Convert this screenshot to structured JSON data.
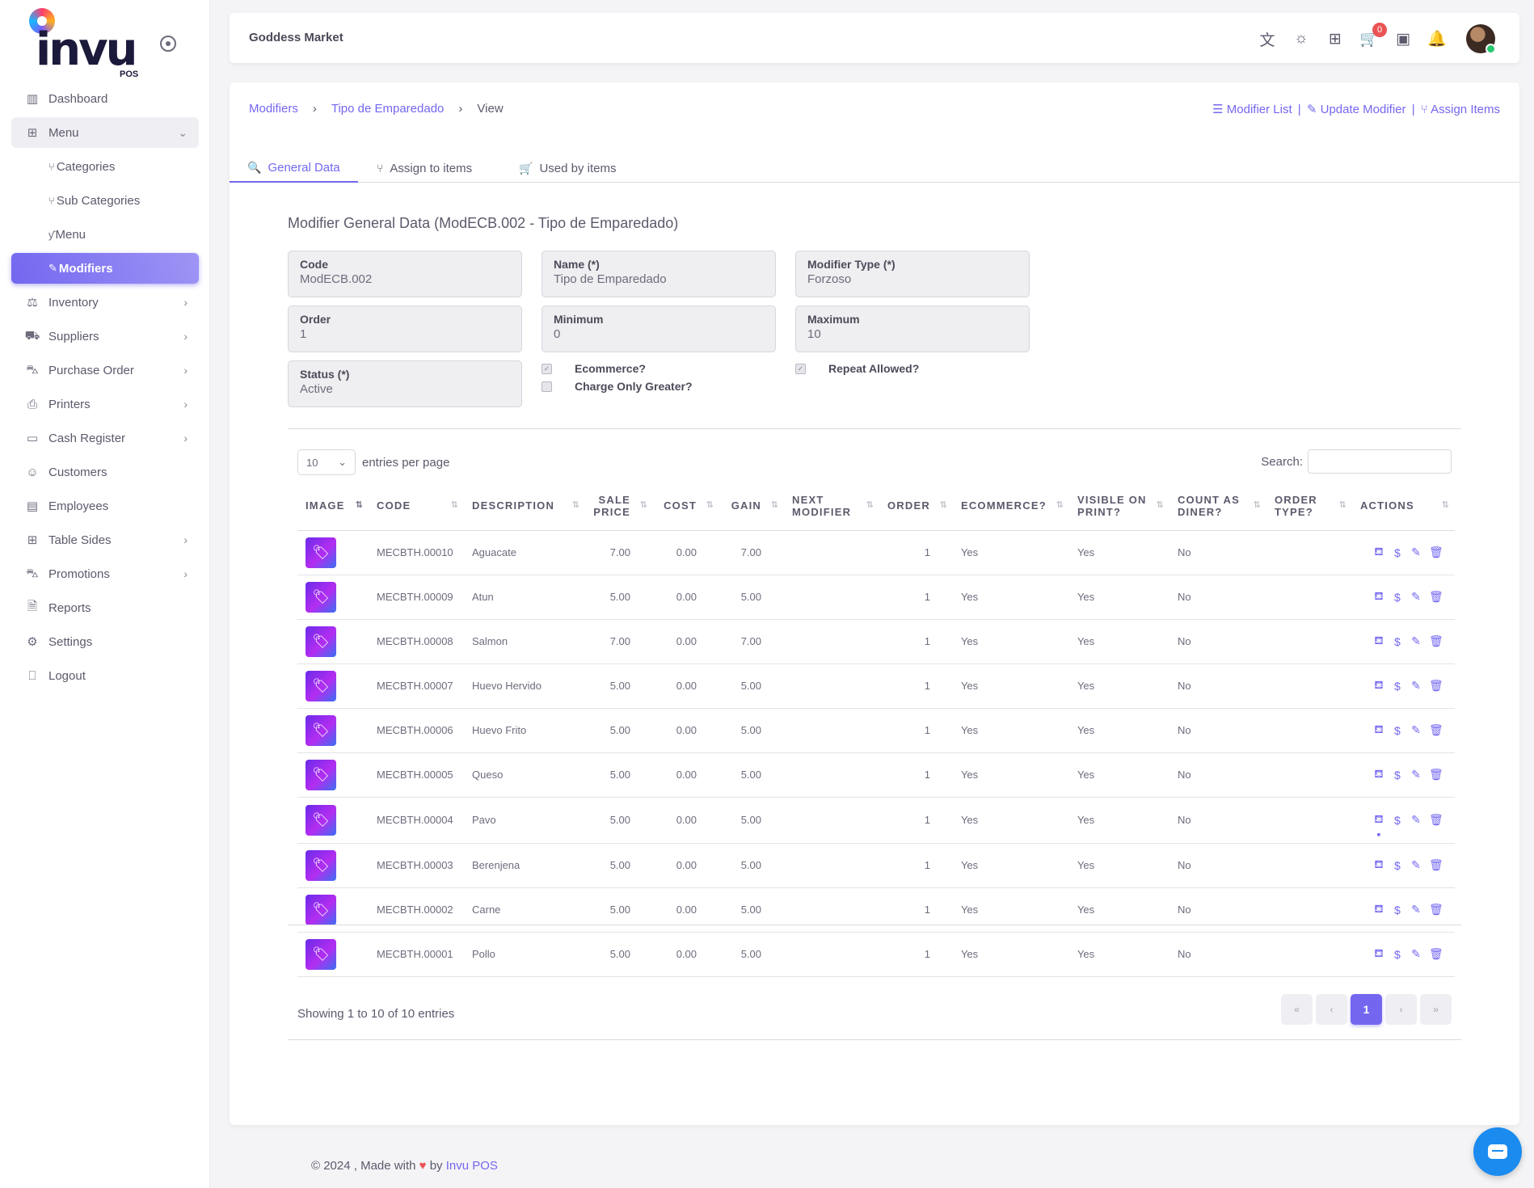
{
  "brand": {
    "name": "invu",
    "sub": "POS"
  },
  "sidebar": {
    "items": [
      {
        "label": "Dashboard",
        "icon": "chart-icon",
        "has_chevron": false
      },
      {
        "label": "Menu",
        "icon": "grid-icon",
        "has_chevron": true,
        "open": true
      }
    ],
    "menu_sub": [
      {
        "label": "Categories",
        "icon": "sitemap-icon"
      },
      {
        "label": "Sub Categories",
        "icon": "sitemap-icon"
      },
      {
        "label": "Menu",
        "icon": "fork-knife-icon"
      },
      {
        "label": "Modifiers",
        "icon": "edit-icon",
        "active": true
      }
    ],
    "items_after": [
      {
        "label": "Inventory",
        "icon": "scale-icon",
        "has_chevron": true
      },
      {
        "label": "Suppliers",
        "icon": "truck-icon",
        "has_chevron": true
      },
      {
        "label": "Purchase Order",
        "icon": "cart-icon",
        "has_chevron": true
      },
      {
        "label": "Printers",
        "icon": "printer-icon",
        "has_chevron": true
      },
      {
        "label": "Cash Register",
        "icon": "register-icon",
        "has_chevron": true
      },
      {
        "label": "Customers",
        "icon": "users-icon",
        "has_chevron": false
      },
      {
        "label": "Employees",
        "icon": "briefcase-icon",
        "has_chevron": false
      },
      {
        "label": "Table Sides",
        "icon": "table-icon",
        "has_chevron": true
      },
      {
        "label": "Promotions",
        "icon": "cart-icon",
        "has_chevron": true
      },
      {
        "label": "Reports",
        "icon": "file-icon",
        "has_chevron": false
      },
      {
        "label": "Settings",
        "icon": "gear-icon",
        "has_chevron": false
      },
      {
        "label": "Logout",
        "icon": "logout-icon",
        "has_chevron": false
      }
    ]
  },
  "topbar": {
    "store_name": "Goddess Market",
    "cart_count": "0"
  },
  "breadcrumb": {
    "first": "Modifiers",
    "second": "Tipo de Emparedado",
    "current": "View"
  },
  "top_links": {
    "list": "Modifier List",
    "update": "Update Modifier",
    "assign": "Assign Items"
  },
  "tabs": {
    "general": "General Data",
    "assign": "Assign to items",
    "used": "Used by items"
  },
  "section_title": "Modifier General Data (ModECB.002 - Tipo de Emparedado)",
  "fields": {
    "code": {
      "label": "Code",
      "value": "ModECB.002"
    },
    "name": {
      "label": "Name (*)",
      "value": "Tipo de Emparedado"
    },
    "type": {
      "label": "Modifier Type (*)",
      "value": "Forzoso"
    },
    "order": {
      "label": "Order",
      "value": "1"
    },
    "minimum": {
      "label": "Minimum",
      "value": "0"
    },
    "maximum": {
      "label": "Maximum",
      "value": "10"
    },
    "status": {
      "label": "Status (*)",
      "value": "Active"
    }
  },
  "checks": {
    "ecommerce": {
      "label": "Ecommerce?",
      "checked": true
    },
    "charge_greater": {
      "label": "Charge Only Greater?",
      "checked": false
    },
    "repeat": {
      "label": "Repeat Allowed?",
      "checked": true
    }
  },
  "table_controls": {
    "page_size": "10",
    "entries_label": "entries per page",
    "search_label": "Search:"
  },
  "table": {
    "headers": {
      "image": "IMAGE",
      "code": "CODE",
      "description": "DESCRIPTION",
      "sale_price_1": "SALE",
      "sale_price_2": "PRICE",
      "cost": "COST",
      "gain": "GAIN",
      "next_1": "NEXT",
      "next_2": "MODIFIER",
      "order": "ORDER",
      "ecommerce": "ECOMMERCE?",
      "visible_1": "VISIBLE ON",
      "visible_2": "PRINT?",
      "diner_1": "COUNT AS",
      "diner_2": "DINER?",
      "otype_1": "ORDER",
      "otype_2": "TYPE?",
      "actions": "ACTIONS"
    },
    "rows": [
      {
        "code": "MECBTH.00010",
        "description": "Aguacate",
        "sale_price": "7.00",
        "cost": "0.00",
        "gain": "7.00",
        "next": "",
        "order": "1",
        "ecommerce": "Yes",
        "visible": "Yes",
        "diner": "No",
        "order_type": ""
      },
      {
        "code": "MECBTH.00009",
        "description": "Atun",
        "sale_price": "5.00",
        "cost": "0.00",
        "gain": "5.00",
        "next": "",
        "order": "1",
        "ecommerce": "Yes",
        "visible": "Yes",
        "diner": "No",
        "order_type": ""
      },
      {
        "code": "MECBTH.00008",
        "description": "Salmon",
        "sale_price": "7.00",
        "cost": "0.00",
        "gain": "7.00",
        "next": "",
        "order": "1",
        "ecommerce": "Yes",
        "visible": "Yes",
        "diner": "No",
        "order_type": ""
      },
      {
        "code": "MECBTH.00007",
        "description": "Huevo Hervido",
        "sale_price": "5.00",
        "cost": "0.00",
        "gain": "5.00",
        "next": "",
        "order": "1",
        "ecommerce": "Yes",
        "visible": "Yes",
        "diner": "No",
        "order_type": ""
      },
      {
        "code": "MECBTH.00006",
        "description": "Huevo Frito",
        "sale_price": "5.00",
        "cost": "0.00",
        "gain": "5.00",
        "next": "",
        "order": "1",
        "ecommerce": "Yes",
        "visible": "Yes",
        "diner": "No",
        "order_type": ""
      },
      {
        "code": "MECBTH.00005",
        "description": "Queso",
        "sale_price": "5.00",
        "cost": "0.00",
        "gain": "5.00",
        "next": "",
        "order": "1",
        "ecommerce": "Yes",
        "visible": "Yes",
        "diner": "No",
        "order_type": ""
      },
      {
        "code": "MECBTH.00004",
        "description": "Pavo",
        "sale_price": "5.00",
        "cost": "0.00",
        "gain": "5.00",
        "next": "",
        "order": "1",
        "ecommerce": "Yes",
        "visible": "Yes",
        "diner": "No",
        "order_type": "",
        "extra_action": true
      },
      {
        "code": "MECBTH.00003",
        "description": "Berenjena",
        "sale_price": "5.00",
        "cost": "0.00",
        "gain": "5.00",
        "next": "",
        "order": "1",
        "ecommerce": "Yes",
        "visible": "Yes",
        "diner": "No",
        "order_type": ""
      },
      {
        "code": "MECBTH.00002",
        "description": "Carne",
        "sale_price": "5.00",
        "cost": "0.00",
        "gain": "5.00",
        "next": "",
        "order": "1",
        "ecommerce": "Yes",
        "visible": "Yes",
        "diner": "No",
        "order_type": ""
      },
      {
        "code": "MECBTH.00001",
        "description": "Pollo",
        "sale_price": "5.00",
        "cost": "0.00",
        "gain": "5.00",
        "next": "",
        "order": "1",
        "ecommerce": "Yes",
        "visible": "Yes",
        "diner": "No",
        "order_type": ""
      }
    ]
  },
  "pagination": {
    "showing": "Showing 1 to 10 of 10 entries",
    "first": "«",
    "prev": "‹",
    "current": "1",
    "next": "›",
    "last": "»"
  },
  "footer": {
    "prefix": "© 2024 , Made with",
    "by": "by",
    "link": "Invu POS"
  },
  "colors": {
    "accent": "#7367f0",
    "danger": "#ea5455",
    "success": "#28c76f",
    "chat": "#1b8bf0"
  }
}
